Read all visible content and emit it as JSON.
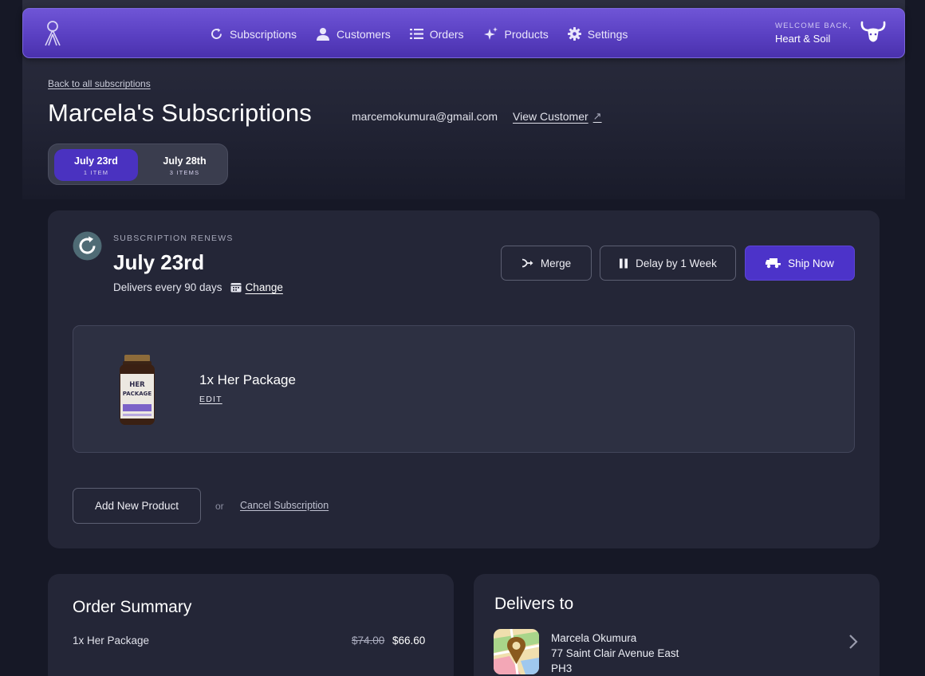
{
  "nav": {
    "items": [
      {
        "label": "Subscriptions",
        "icon": "refresh-icon"
      },
      {
        "label": "Customers",
        "icon": "user-icon"
      },
      {
        "label": "Orders",
        "icon": "list-icon"
      },
      {
        "label": "Products",
        "icon": "sparkle-icon"
      },
      {
        "label": "Settings",
        "icon": "gear-icon"
      }
    ],
    "welcome_label": "WELCOME BACK,",
    "store_name": "Heart & Soil"
  },
  "header": {
    "back_link": "Back to all subscriptions",
    "title": "Marcela's Subscriptions",
    "email": "marcemokumura@gmail.com",
    "view_customer": "View Customer"
  },
  "date_tabs": [
    {
      "date": "July 23rd",
      "count": "1 ITEM",
      "active": true
    },
    {
      "date": "July 28th",
      "count": "3 ITEMS",
      "active": false
    }
  ],
  "subscription": {
    "renews_label": "SUBSCRIPTION RENEWS",
    "renew_date": "July 23rd",
    "delivers_text": "Delivers every 90 days",
    "change_label": "Change",
    "actions": {
      "merge": "Merge",
      "delay": "Delay by 1 Week",
      "ship": "Ship Now"
    },
    "product": {
      "name": "1x Her Package",
      "edit_label": "EDIT",
      "label_text": "HER PACKAGE"
    },
    "add_product": "Add New Product",
    "or_text": "or",
    "cancel_link": "Cancel Subscription"
  },
  "order_summary": {
    "title": "Order Summary",
    "items": [
      {
        "name": "1x Her Package",
        "original_price": "$74.00",
        "price": "$66.60"
      }
    ]
  },
  "delivers_to": {
    "title": "Delivers to",
    "name": "Marcela Okumura",
    "line1": "77 Saint Clair Avenue East",
    "line2": "PH3"
  },
  "colors": {
    "accent": "#4c33c9",
    "nav": "#5a40c2",
    "background": "#161826",
    "card": "#242637"
  }
}
